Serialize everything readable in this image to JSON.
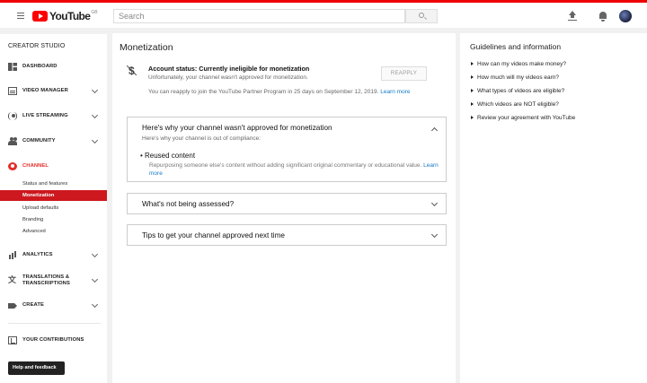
{
  "header": {
    "logo_text": "YouTube",
    "logo_region": "GB",
    "search_placeholder": "Search",
    "icons": [
      "menu-icon",
      "search-icon",
      "upload-icon",
      "notifications-icon",
      "avatar"
    ]
  },
  "sidebar": {
    "title": "CREATOR STUDIO",
    "items": [
      {
        "label": "DASHBOARD",
        "icon": "dashboard-icon"
      },
      {
        "label": "VIDEO MANAGER",
        "icon": "video-manager-icon"
      },
      {
        "label": "LIVE STREAMING",
        "icon": "live-streaming-icon"
      },
      {
        "label": "COMMUNITY",
        "icon": "community-icon"
      },
      {
        "label": "CHANNEL",
        "icon": "channel-icon"
      },
      {
        "label": "ANALYTICS",
        "icon": "analytics-icon"
      },
      {
        "label": "TRANSLATIONS & TRANSCRIPTIONS",
        "icon": "translate-icon"
      },
      {
        "label": "CREATE",
        "icon": "create-icon"
      },
      {
        "label": "YOUR CONTRIBUTIONS",
        "icon": "contributions-icon"
      }
    ],
    "channel_sub": [
      "Status and features",
      "Monetization",
      "Upload defaults",
      "Branding",
      "Advanced"
    ],
    "help": "Help and feedback"
  },
  "main": {
    "title": "Monetization",
    "status_title": "Account status: Currently ineligible for monetization",
    "status_sub": "Unfortunately, your channel wasn't approved for monetization.",
    "reapply": "REAPPLY",
    "reapply_note": "You can reapply to join the YouTube Partner Program in 25 days on September 12, 2019.",
    "learn_more": "Learn more",
    "sections": [
      {
        "title": "Here's why your channel wasn't approved for monetization",
        "subtitle": "Here's why your channel is out of compliance:",
        "bullet": "Reused content",
        "reason": "Repurposing someone else's content without adding significant original commentary or educational value.",
        "learn_more": "Learn more"
      },
      {
        "title": "What's not being assessed?"
      },
      {
        "title": "Tips to get your channel approved next time"
      }
    ]
  },
  "guidelines": {
    "title": "Guidelines and information",
    "items": [
      "How can my videos make money?",
      "How much will my videos earn?",
      "What types of videos are eligible?",
      "Which videos are NOT eligible?",
      "Review your agreement with YouTube"
    ]
  },
  "colors": {
    "brand_red": "#e52d27",
    "active_bg": "#cc181e",
    "link": "#167ac6"
  }
}
